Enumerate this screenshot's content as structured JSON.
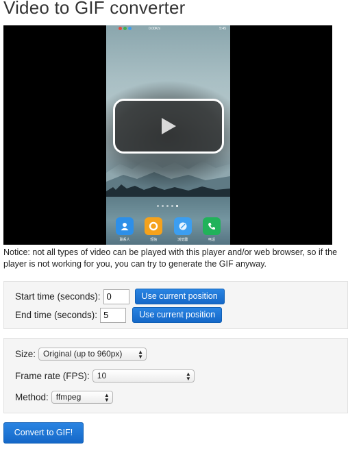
{
  "page": {
    "title": "Video to GIF converter"
  },
  "video": {
    "status_time": "5:45",
    "status_speed": "0.00K/s",
    "dock_apps": [
      {
        "label": "联系人",
        "icon": "contacts-icon",
        "color": "#2d8fe8"
      },
      {
        "label": "短信",
        "icon": "messages-icon",
        "color": "#f5a21b"
      },
      {
        "label": "浏览器",
        "icon": "browser-icon",
        "color": "#3c9ef0"
      },
      {
        "label": "电话",
        "icon": "phone-icon",
        "color": "#21b25a"
      }
    ]
  },
  "notice": {
    "text": "Notice: not all types of video can be played with this player and/or web browser, so if the player is not working for you, you can try to generate the GIF anyway."
  },
  "times": {
    "start_label": "Start time (seconds):",
    "start_value": "0",
    "end_label": "End time (seconds):",
    "end_value": "5",
    "use_current_label": "Use current position"
  },
  "options": {
    "size_label": "Size:",
    "size_value": "Original (up to 960px)",
    "fps_label": "Frame rate (FPS):",
    "fps_value": "10",
    "method_label": "Method:",
    "method_value": "ffmpeg"
  },
  "actions": {
    "convert_label": "Convert to GIF!"
  },
  "colors": {
    "button_blue": "#1a73d6",
    "panel_bg": "#f5f5f5"
  }
}
